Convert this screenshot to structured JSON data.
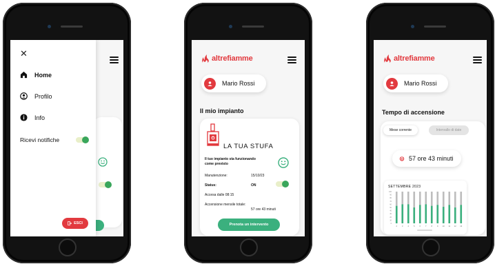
{
  "brand": {
    "name": "altrefiamme",
    "color": "#e23a3f",
    "accent_green": "#3bb07e"
  },
  "user": {
    "name": "Mario Rossi"
  },
  "menu": {
    "items": [
      {
        "label": "Home",
        "icon": "home-icon",
        "bold": true
      },
      {
        "label": "Profilo",
        "icon": "profile-icon",
        "bold": false
      },
      {
        "label": "Info",
        "icon": "info-icon",
        "bold": false
      }
    ],
    "notifications_label": "Ricevi notifiche",
    "notifications_on": true,
    "logout_label": "ESCI"
  },
  "impianto": {
    "section_title": "Il mio impianto",
    "device_label": "LA TUA STUFA",
    "status_message": "Il tuo impianto sta funzionando come previsto",
    "rows": [
      {
        "label": "Manutenzione:",
        "value": "15/10/23"
      },
      {
        "label": "Status:",
        "value": "ON"
      }
    ],
    "lit_since": "Accesa dalle 08:15",
    "monthly_label": "Accensione mensile totale:",
    "monthly_value": "57 ore 43 minuti",
    "book_button": "Prenota un intervento"
  },
  "accensione": {
    "section_title": "Tempo di accensione",
    "tabs": [
      {
        "label": "Mese corrente",
        "active": true
      },
      {
        "label": "Intervallo di date",
        "active": false
      }
    ],
    "total": "57 ore 43 minuti"
  },
  "chart_data": {
    "type": "bar",
    "title": "SETTEMBRE 2023",
    "categories": [
      "2",
      "3",
      "4",
      "5",
      "6",
      "7",
      "8",
      "9",
      "10",
      "11",
      "12",
      "13"
    ],
    "series": [
      {
        "values": [
          100,
          100,
          100,
          100,
          100,
          100,
          100,
          100,
          100,
          100,
          100,
          100
        ]
      },
      {
        "values": [
          55,
          60,
          60,
          50,
          58,
          60,
          55,
          58,
          52,
          58,
          50,
          58
        ]
      }
    ],
    "ylim": [
      0,
      100
    ],
    "yticks": [
      0,
      10,
      20,
      30,
      40,
      50,
      60,
      70,
      80,
      90,
      100
    ]
  }
}
